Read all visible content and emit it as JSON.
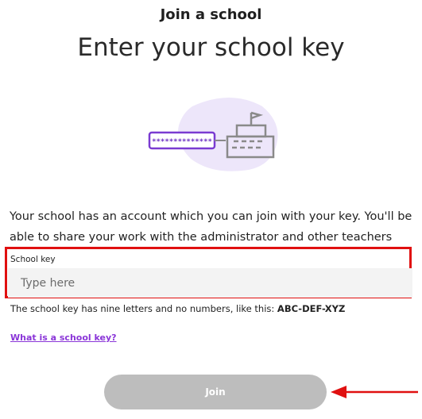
{
  "header": {
    "subtitle": "Join a school",
    "title": "Enter your school key"
  },
  "illustration": {
    "masked_key": "**************",
    "icons": [
      "password-field-icon",
      "school-building-icon"
    ]
  },
  "description": "Your school has an account which you can join with your key. You'll be able to share your work with the administrator and other teachers",
  "form": {
    "field_label": "School key",
    "placeholder": "Type here",
    "value": "",
    "hint_prefix": "The school key has nine letters and no numbers, like this: ",
    "hint_example": "ABC-DEF-XYZ",
    "help_link": "What is a school key?",
    "join_label": "Join"
  },
  "annotation": {
    "highlight_color": "#e01010",
    "arrow_color": "#e01010"
  },
  "colors": {
    "accent_purple": "#8a35d8",
    "button_disabled": "#bdbdbd"
  }
}
